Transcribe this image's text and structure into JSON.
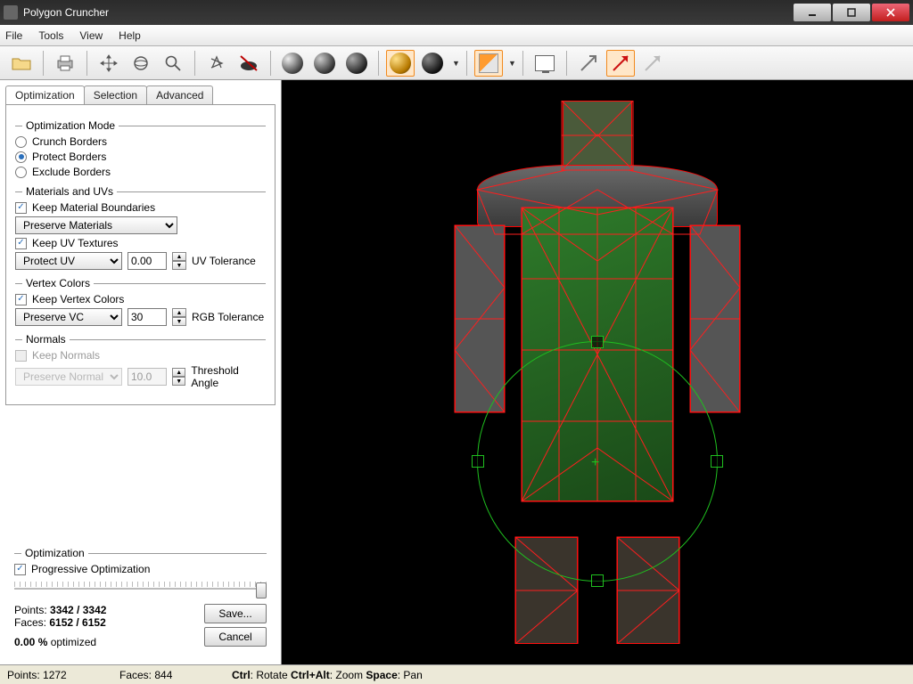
{
  "window": {
    "title": "Polygon Cruncher"
  },
  "menu": {
    "file": "File",
    "tools": "Tools",
    "view": "View",
    "help": "Help"
  },
  "tabs": {
    "optimization": "Optimization",
    "selection": "Selection",
    "advanced": "Advanced"
  },
  "groups": {
    "optmode": "Optimization Mode",
    "matuv": "Materials and UVs",
    "vcolors": "Vertex Colors",
    "normals": "Normals",
    "optimization": "Optimization"
  },
  "optmode": {
    "crunch": "Crunch Borders",
    "protect": "Protect Borders",
    "exclude": "Exclude Borders",
    "selected": "protect"
  },
  "matuv": {
    "keep_boundaries": "Keep Material Boundaries",
    "preserve_materials": "Preserve Materials",
    "keep_uv": "Keep UV Textures",
    "protect_uv": "Protect UV",
    "uv_tol_value": "0.00",
    "uv_tol_label": "UV Tolerance"
  },
  "vcolors": {
    "keep_vc": "Keep Vertex Colors",
    "preserve_vc": "Preserve VC",
    "rgb_tol_value": "30",
    "rgb_tol_label": "RGB Tolerance"
  },
  "normals": {
    "keep_normals": "Keep Normals",
    "preserve_normals": "Preserve Normals",
    "threshold_value": "10.0",
    "threshold_label": "Threshold Angle"
  },
  "bottom": {
    "progressive": "Progressive Optimization",
    "points_label": "Points:",
    "points_value": "3342 / 3342",
    "faces_label": "Faces:",
    "faces_value": "6152 / 6152",
    "opt_pct": "0.00 %",
    "opt_word": "optimized",
    "save": "Save...",
    "cancel": "Cancel"
  },
  "status": {
    "points_label": "Points:",
    "points_value": "1272",
    "faces_label": "Faces:",
    "faces_value": "844",
    "hint_ctrl": "Ctrl",
    "hint_rotate": ": Rotate ",
    "hint_ctrlalt": "Ctrl+Alt",
    "hint_zoom": ": Zoom ",
    "hint_space": "Space",
    "hint_pan": ": Pan"
  }
}
